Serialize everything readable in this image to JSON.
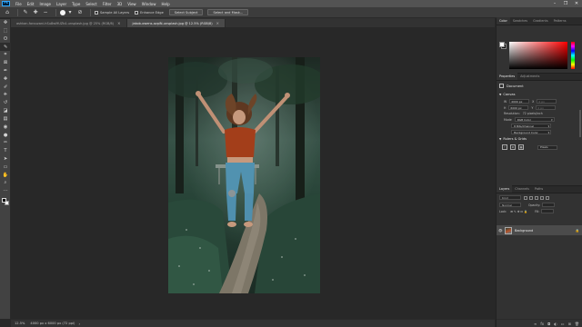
{
  "app": {
    "logo": "Ps",
    "menu": [
      "File",
      "Edit",
      "Image",
      "Layer",
      "Type",
      "Select",
      "Filter",
      "3D",
      "View",
      "Window",
      "Help"
    ],
    "window_controls": [
      "–",
      "❐",
      "✕"
    ]
  },
  "options_bar": {
    "tools": [
      "house-icon",
      "quick-selection-icon",
      "add-selection-icon",
      "subtract-selection-icon"
    ],
    "sample_all_layers": "Sample All Layers",
    "enhance_edge": "Enhance Edge",
    "select_subject": "Select Subject",
    "select_and_mask": "Select and Mask..."
  },
  "tabs": [
    {
      "label": "ashkan-forouzani-hSu8wl9UZk4-unsplash.jpg @ 25% (RGB/8)",
      "active": false
    },
    {
      "label": "jakob-owens-ozpiN-unsplash.jpg @ 12.5% (RGB/8)",
      "active": true
    }
  ],
  "toolbar": {
    "tools": [
      "move-icon",
      "marquee-icon",
      "lasso-icon",
      "quick-select-icon",
      "crop-icon",
      "frame-icon",
      "eyedropper-icon",
      "healing-icon",
      "brush-icon",
      "stamp-icon",
      "history-brush-icon",
      "eraser-icon",
      "gradient-icon",
      "blur-icon",
      "dodge-icon",
      "pen-icon",
      "type-icon",
      "path-select-icon",
      "rectangle-icon",
      "hand-icon",
      "zoom-icon",
      "more-tools-icon"
    ],
    "tool_glyphs": [
      "✥",
      "⬚",
      "ʘ",
      "✎",
      "⌗",
      "⊠",
      "✒",
      "✚",
      "✐",
      "⎈",
      "↺",
      "◪",
      "▤",
      "◉",
      "●",
      "✑",
      "T",
      "➤",
      "▭",
      "✋",
      "⌕",
      "⋯"
    ],
    "active_index": 3,
    "foreground": "#000000",
    "background": "#ffffff"
  },
  "status": {
    "zoom": "12.5%",
    "info": "4000 px x 6000 px (72 ppi)",
    "arrow": "›"
  },
  "color_panel": {
    "tabs": [
      "Color",
      "Swatches",
      "Gradients",
      "Patterns"
    ],
    "foreground": "#ffffff",
    "background": "#111111"
  },
  "properties": {
    "tabs": [
      "Properties",
      "Adjustments"
    ],
    "type": "Document",
    "canvas_title": "Canvas",
    "width": "4000 px",
    "height": "6000 px",
    "x": "0 px",
    "y": "0 px",
    "resolution_label": "Resolution:",
    "resolution": "72 pixels/inch",
    "mode_label": "Mode",
    "mode": "RGB Color",
    "depth": "8 Bits/Channel",
    "fill": "Background Color",
    "rulers_title": "Rulers & Grids",
    "units": "Pixels"
  },
  "layers": {
    "tabs": [
      "Layers",
      "Channels",
      "Paths"
    ],
    "kind": "Kind",
    "blend": "Normal",
    "opacity_label": "Opacity:",
    "lock_label": "Lock:",
    "fill_label": "Fill:",
    "items": [
      {
        "name": "Background",
        "visible": true,
        "locked": true
      }
    ],
    "footer_icons": [
      "link-icon",
      "fx-icon",
      "mask-icon",
      "adjustment-icon",
      "group-icon",
      "new-layer-icon",
      "trash-icon"
    ],
    "footer_glyphs": [
      "∞",
      "fx",
      "◘",
      "◐",
      "▭",
      "⊞",
      "🗑"
    ]
  }
}
